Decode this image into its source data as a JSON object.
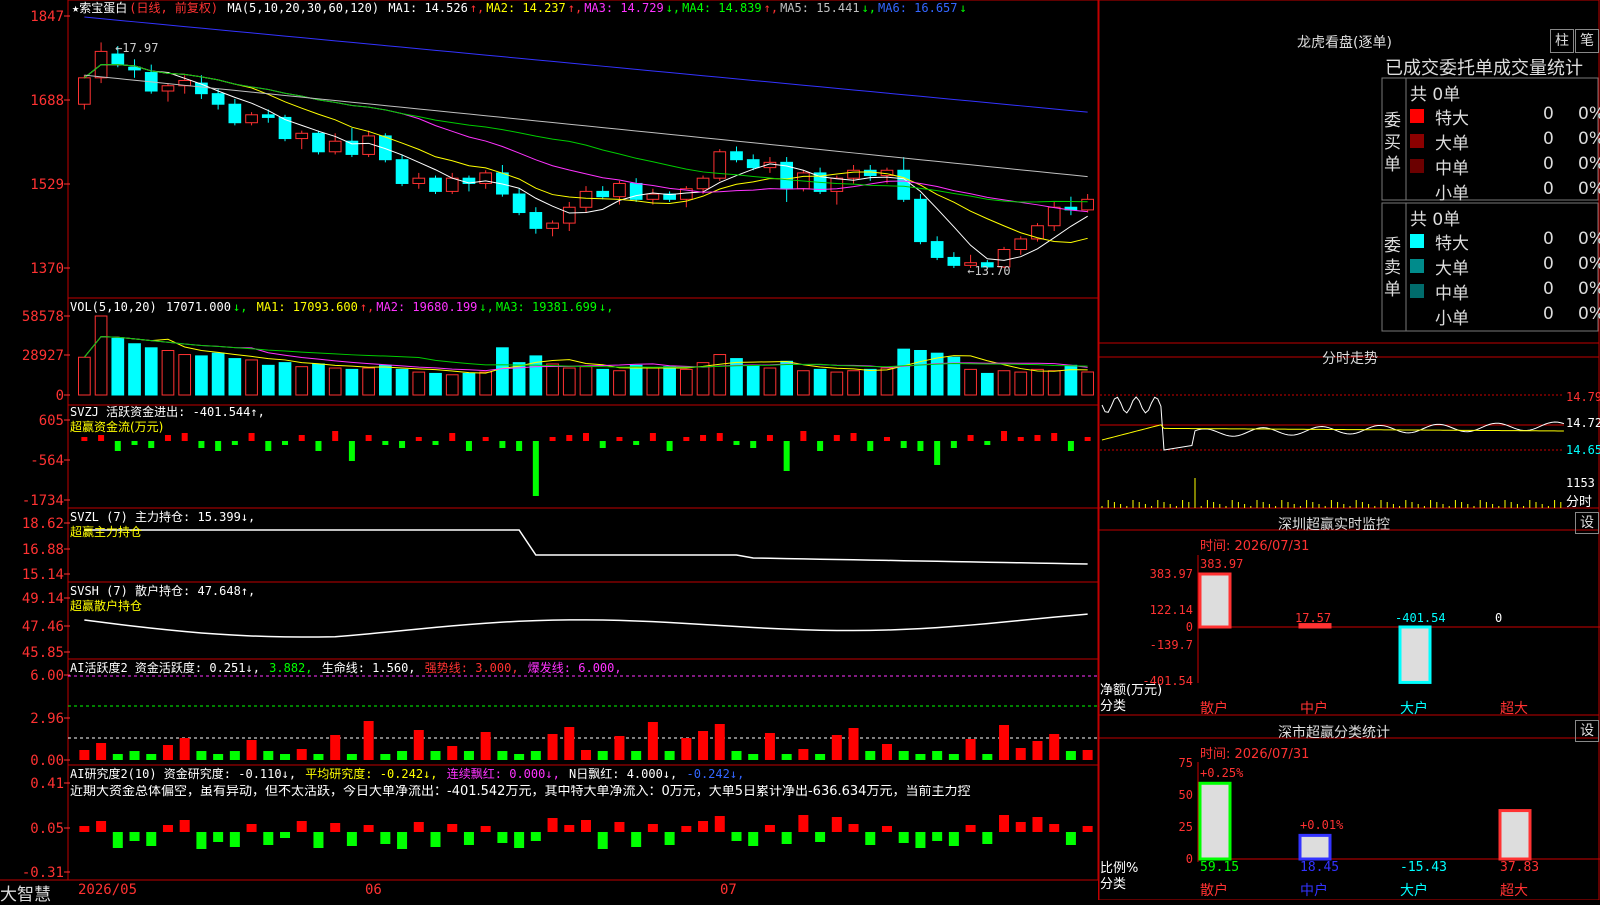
{
  "stock": {
    "name": "★索宝蛋白",
    "mode": "(日线, 前复权)"
  },
  "brand": "大智慧",
  "date_labels": [
    "2026/05",
    "06",
    "07"
  ],
  "colors": {
    "up": "#ff3232",
    "down": "#00ffff",
    "ma1": "#ffffff",
    "ma2": "#ffff00",
    "ma3": "#ff33ff",
    "ma4": "#00cc00",
    "ma5": "#c0c0c0",
    "ma6": "#3333ff"
  },
  "main": {
    "ma_header": "MA(5,10,20,30,60,120)",
    "ma": [
      {
        "label": "MA1:",
        "value": "14.526",
        "arrow": "↑",
        "cls": "wht"
      },
      {
        "label": "MA2:",
        "value": "14.237",
        "arrow": "↑",
        "cls": "yel"
      },
      {
        "label": "MA3:",
        "value": "14.729",
        "arrow": "↓",
        "cls": "mag"
      },
      {
        "label": "MA4:",
        "value": "14.839",
        "arrow": "↑",
        "cls": "grn"
      },
      {
        "label": "MA5:",
        "value": "15.441",
        "arrow": "↓",
        "cls": "gray"
      },
      {
        "label": "MA6:",
        "value": "16.657",
        "arrow": "↓",
        "cls": "blu"
      }
    ],
    "yticks": [
      "1847",
      "1688",
      "1529",
      "1370"
    ],
    "high_label": "17.97",
    "low_label": "13.70"
  },
  "vol": {
    "header": "VOL(5,10,20)",
    "value": "17071.000",
    "ma": [
      {
        "label": "MA1:",
        "value": "17093.600",
        "arrow": "↑",
        "cls": "yel"
      },
      {
        "label": "MA2:",
        "value": "19680.199",
        "arrow": "↓",
        "cls": "mag"
      },
      {
        "label": "MA3:",
        "value": "19381.699",
        "arrow": "↓",
        "cls": "grn"
      }
    ],
    "yticks": [
      "58578",
      "28927",
      "0"
    ]
  },
  "svzj": {
    "header": "SVZJ  活跃资金进出: -401.544↑,",
    "sub": "超赢资金流(万元)",
    "yticks": [
      "605",
      "-564",
      "-1734"
    ]
  },
  "svzl": {
    "header": "SVZL (7) 主力持仓: 15.399↓,",
    "sub": "超赢主力持仓",
    "yticks": [
      "18.62",
      "16.88",
      "15.14"
    ]
  },
  "svsh": {
    "header": "SVSH (7) 散户持仓: 47.648↑,",
    "sub": "超赢散户持仓",
    "yticks": [
      "49.14",
      "47.46",
      "45.85"
    ]
  },
  "ai1": {
    "header_parts": [
      {
        "t": "AI活跃度2 资金活跃度: 0.251↓, ",
        "cls": "wht"
      },
      {
        "t": "3.882, ",
        "cls": "grn"
      },
      {
        "t": "生命线: 1.560, ",
        "cls": "wht"
      },
      {
        "t": "强势线: 3.000, ",
        "cls": "red"
      },
      {
        "t": "爆发线: 6.000,",
        "cls": "mag"
      }
    ],
    "yticks": [
      "6.00",
      "2.96",
      "0.00"
    ]
  },
  "ai2": {
    "header_parts": [
      {
        "t": "AI研究度2(10) 资金研究度: -0.110↓, ",
        "cls": "wht"
      },
      {
        "t": "平均研究度: -0.242↓, ",
        "cls": "yel"
      },
      {
        "t": "连续飘红: 0.000↓, ",
        "cls": "mag"
      },
      {
        "t": "N日飘红: 4.000↓, ",
        "cls": "wht"
      },
      {
        "t": "-0.242↓,",
        "cls": "blu"
      }
    ],
    "comment": "近期大资金总体偏空，虽有异动，但不太活跃，今日大单净流出：-401.542万元，其中特大单净流入：0万元，大单5日累计净出-636.634万元，当前主力控",
    "yticks": [
      "0.41",
      "0.05",
      "-0.31"
    ]
  },
  "longhu": {
    "title": "龙虎看盘(逐单)",
    "btn1": "柱",
    "btn2": "笔",
    "header": "已成交委托单成交量统计",
    "buy_label": "委买单",
    "sell_label": "委卖单",
    "buy": {
      "total": "共 0单",
      "rows": [
        {
          "label": "特大",
          "count": "0",
          "pct": "0%",
          "color": "#ff0000"
        },
        {
          "label": "大单",
          "count": "0",
          "pct": "0%",
          "color": "#8b0000"
        },
        {
          "label": "中单",
          "count": "0",
          "pct": "0%",
          "color": "#6b0000"
        },
        {
          "label": "小单",
          "count": "0",
          "pct": "0%",
          "color": ""
        }
      ]
    },
    "sell": {
      "total": "共 0单",
      "rows": [
        {
          "label": "特大",
          "count": "0",
          "pct": "0%",
          "color": "#00ffff"
        },
        {
          "label": "大单",
          "count": "0",
          "pct": "0%",
          "color": "#008b8b"
        },
        {
          "label": "中单",
          "count": "0",
          "pct": "0%",
          "color": "#006b6b"
        },
        {
          "label": "小单",
          "count": "0",
          "pct": "0%",
          "color": ""
        }
      ]
    }
  },
  "fenshi": {
    "title": "分时走势",
    "prices": [
      "14.79",
      "14.72",
      "14.65"
    ],
    "vol_label": "1153",
    "fen_label": "分时"
  },
  "sz_monitor": {
    "title": "深圳超赢实时监控",
    "btn": "设",
    "date": "时间: 2026/07/31",
    "yticks": [
      "383.97",
      "122.14",
      "0",
      "-139.7",
      "-401.54"
    ],
    "axis_label1": "净额(万元)",
    "axis_label2": "分类",
    "bars": [
      {
        "cat": "散户",
        "value": "383.97"
      },
      {
        "cat": "中户",
        "value": "17.57"
      },
      {
        "cat": "大户",
        "value": "-401.54"
      },
      {
        "cat": "超大",
        "value": "0"
      }
    ]
  },
  "sz_stats": {
    "title": "深市超赢分类统计",
    "btn": "设",
    "date": "时间: 2026/07/31",
    "yticks": [
      "75",
      "50",
      "25",
      "0"
    ],
    "axis_label1": "比例%",
    "axis_label2": "分类",
    "bars": [
      {
        "cat": "散户",
        "value": "59.15",
        "pct": "+0.25%"
      },
      {
        "cat": "中户",
        "value": "18.45",
        "pct": "+0.01%"
      },
      {
        "cat": "大户",
        "value": "-15.43",
        "pct": ""
      },
      {
        "cat": "超大",
        "value": "37.83",
        "pct": ""
      }
    ]
  },
  "chart_data": {
    "type": "candlestick",
    "title": "★索宝蛋白 (日线, 前复权)",
    "x_markers": [
      "2026/05",
      "06",
      "07"
    ],
    "ylim": [
      13.5,
      18.5
    ],
    "ohlc": [
      [
        16.8,
        17.35,
        16.7,
        17.3
      ],
      [
        17.3,
        17.97,
        17.2,
        17.8
      ],
      [
        17.75,
        17.9,
        17.5,
        17.55
      ],
      [
        17.5,
        17.65,
        17.3,
        17.45
      ],
      [
        17.4,
        17.55,
        17.0,
        17.05
      ],
      [
        17.05,
        17.2,
        16.85,
        17.15
      ],
      [
        17.15,
        17.35,
        17.0,
        17.25
      ],
      [
        17.2,
        17.35,
        16.9,
        17.0
      ],
      [
        17.0,
        17.1,
        16.7,
        16.8
      ],
      [
        16.8,
        16.9,
        16.4,
        16.45
      ],
      [
        16.45,
        16.65,
        16.4,
        16.6
      ],
      [
        16.6,
        16.7,
        16.45,
        16.55
      ],
      [
        16.55,
        16.6,
        16.1,
        16.15
      ],
      [
        16.15,
        16.3,
        15.95,
        16.25
      ],
      [
        16.25,
        16.3,
        15.85,
        15.9
      ],
      [
        15.9,
        16.25,
        15.85,
        16.1
      ],
      [
        16.1,
        16.35,
        15.8,
        15.85
      ],
      [
        15.85,
        16.3,
        15.8,
        16.2
      ],
      [
        16.2,
        16.25,
        15.7,
        15.75
      ],
      [
        15.75,
        15.85,
        15.25,
        15.3
      ],
      [
        15.3,
        15.5,
        15.2,
        15.4
      ],
      [
        15.4,
        15.45,
        15.1,
        15.15
      ],
      [
        15.15,
        15.5,
        15.1,
        15.4
      ],
      [
        15.4,
        15.45,
        15.15,
        15.3
      ],
      [
        15.3,
        15.55,
        15.2,
        15.5
      ],
      [
        15.5,
        15.65,
        15.05,
        15.1
      ],
      [
        15.1,
        15.2,
        14.7,
        14.75
      ],
      [
        14.75,
        14.85,
        14.35,
        14.45
      ],
      [
        14.45,
        14.6,
        14.3,
        14.55
      ],
      [
        14.55,
        14.95,
        14.4,
        14.85
      ],
      [
        14.85,
        15.25,
        14.75,
        15.15
      ],
      [
        15.15,
        15.25,
        15.0,
        15.05
      ],
      [
        15.05,
        15.35,
        14.9,
        15.3
      ],
      [
        15.3,
        15.4,
        14.95,
        15.0
      ],
      [
        15.0,
        15.2,
        14.9,
        15.1
      ],
      [
        15.1,
        15.15,
        14.95,
        15.0
      ],
      [
        15.0,
        15.25,
        14.85,
        15.2
      ],
      [
        15.2,
        15.45,
        15.1,
        15.4
      ],
      [
        15.4,
        15.95,
        15.35,
        15.9
      ],
      [
        15.9,
        16.0,
        15.7,
        15.75
      ],
      [
        15.75,
        15.85,
        15.55,
        15.6
      ],
      [
        15.6,
        15.8,
        15.5,
        15.7
      ],
      [
        15.7,
        15.8,
        14.95,
        15.2
      ],
      [
        15.2,
        15.55,
        15.15,
        15.5
      ],
      [
        15.5,
        15.6,
        15.1,
        15.15
      ],
      [
        15.15,
        15.45,
        14.9,
        15.4
      ],
      [
        15.4,
        15.65,
        15.3,
        15.55
      ],
      [
        15.55,
        15.65,
        15.35,
        15.45
      ],
      [
        15.45,
        15.6,
        15.3,
        15.55
      ],
      [
        15.55,
        15.8,
        14.95,
        15.0
      ],
      [
        15.0,
        15.1,
        14.15,
        14.2
      ],
      [
        14.2,
        14.3,
        13.85,
        13.9
      ],
      [
        13.9,
        14.0,
        13.7,
        13.75
      ],
      [
        13.75,
        13.95,
        13.7,
        13.8
      ],
      [
        13.8,
        13.85,
        13.7,
        13.72
      ],
      [
        13.72,
        14.1,
        13.7,
        14.05
      ],
      [
        14.05,
        14.3,
        13.95,
        14.25
      ],
      [
        14.25,
        14.55,
        14.2,
        14.5
      ],
      [
        14.5,
        14.95,
        14.4,
        14.85
      ],
      [
        14.85,
        15.05,
        14.7,
        14.8
      ],
      [
        14.8,
        15.1,
        14.75,
        15.0
      ]
    ],
    "volume": [
      28000,
      58578,
      42000,
      38000,
      35000,
      33000,
      30000,
      29000,
      31000,
      27000,
      26000,
      22000,
      24000,
      21000,
      23000,
      20000,
      19000,
      20000,
      22000,
      19000,
      17000,
      16000,
      15000,
      16000,
      17000,
      35000,
      24000,
      29000,
      23000,
      20000,
      21000,
      19000,
      18000,
      22000,
      20000,
      21000,
      19000,
      24000,
      30000,
      27000,
      22000,
      20000,
      25000,
      18000,
      19000,
      17000,
      18000,
      19000,
      20000,
      34000,
      33000,
      31000,
      28000,
      19000,
      16000,
      18000,
      17000,
      19000,
      18000,
      22000,
      17071
    ]
  }
}
